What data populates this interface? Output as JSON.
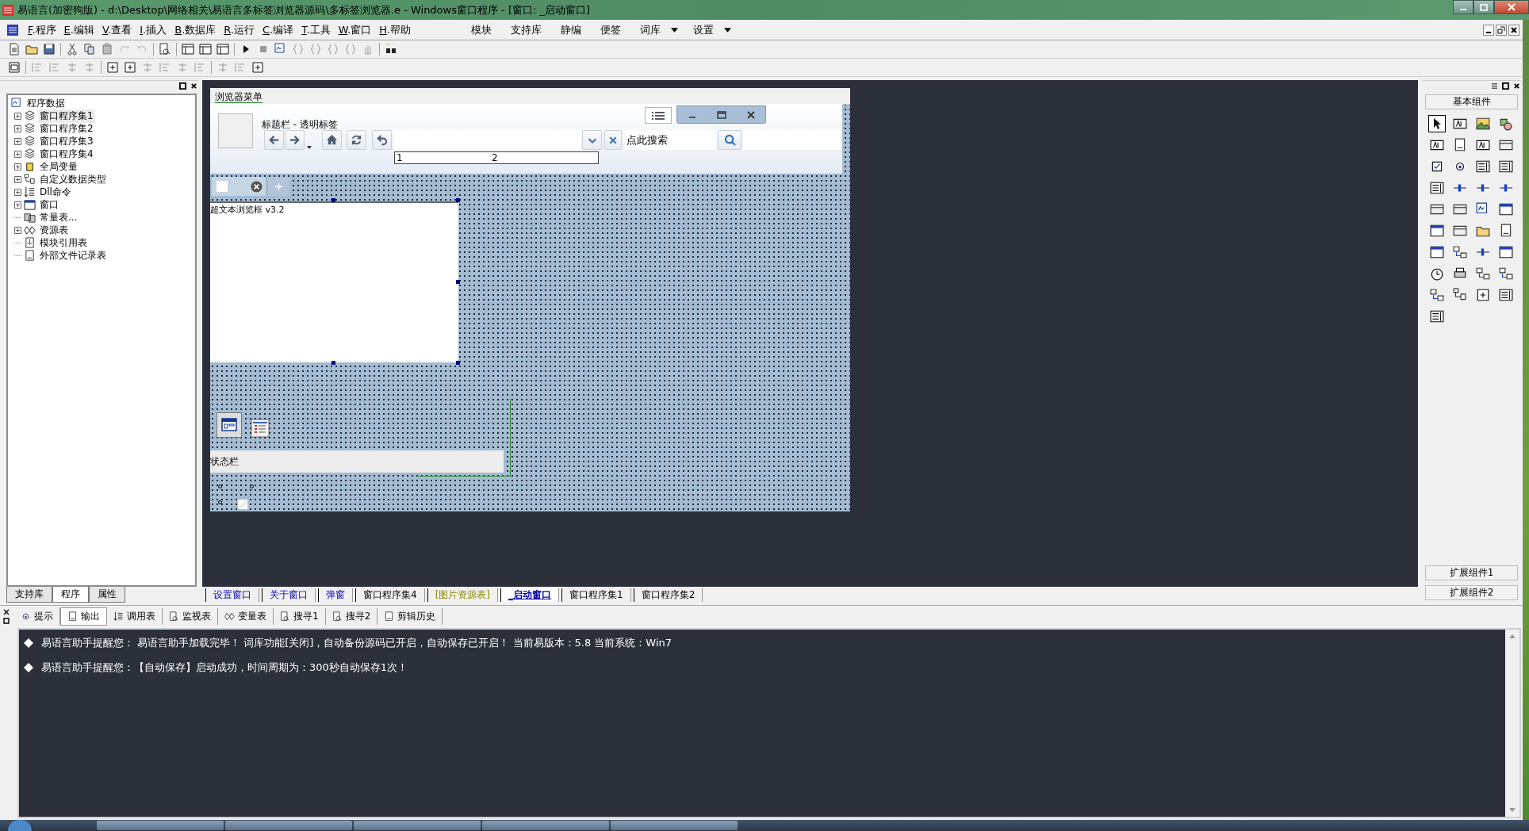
{
  "window": {
    "title": "易语言(加密狗版) - d:\\Desktop\\网络相关\\易语言多标签浏览器源码\\多标签浏览器.e - Windows窗口程序 - [窗口: _启动窗口]"
  },
  "menu": [
    {
      "label": "F.程序"
    },
    {
      "label": "E.编辑"
    },
    {
      "label": "V.查看"
    },
    {
      "label": "I.插入"
    },
    {
      "label": "B.数据库"
    },
    {
      "label": "R.运行"
    },
    {
      "label": "C.编译"
    },
    {
      "label": "T.工具"
    },
    {
      "label": "W.窗口"
    },
    {
      "label": "H.帮助"
    }
  ],
  "menu_right": [
    {
      "label": "模块",
      "dropdown": false
    },
    {
      "label": "支持库",
      "dropdown": false
    },
    {
      "label": "静编",
      "dropdown": false
    },
    {
      "label": "便签",
      "dropdown": false
    },
    {
      "label": "词库",
      "dropdown": true
    },
    {
      "label": "设置",
      "dropdown": true
    }
  ],
  "tree": {
    "label": "程序数据",
    "children": [
      {
        "label": "窗口程序集1",
        "expander": true,
        "selected": true
      },
      {
        "label": "窗口程序集2",
        "expander": true,
        "selected": false
      },
      {
        "label": "窗口程序集3",
        "expander": true,
        "selected": false
      },
      {
        "label": "窗口程序集4",
        "expander": true,
        "selected": false
      },
      {
        "label": "全局变量",
        "expander": true,
        "selected": false
      },
      {
        "label": "自定义数据类型",
        "expander": true,
        "selected": false
      },
      {
        "label": "Dll命令",
        "expander": true,
        "selected": false
      },
      {
        "label": "窗口",
        "expander": true,
        "selected": false
      },
      {
        "label": "常量表...",
        "expander": false,
        "selected": false
      },
      {
        "label": "资源表",
        "expander": true,
        "selected": false
      },
      {
        "label": "模块引用表",
        "expander": false,
        "selected": false
      },
      {
        "label": "外部文件记录表",
        "expander": false,
        "selected": false
      }
    ]
  },
  "left_tabs": [
    {
      "label": "支持库",
      "selected": false
    },
    {
      "label": "程序",
      "selected": true
    },
    {
      "label": "属性",
      "selected": false
    }
  ],
  "designer": {
    "menu_label": "浏览器菜单",
    "title_label": "标题栏 - 透明标签",
    "ruler": [
      "1",
      "2"
    ],
    "search_placeholder": "点此搜索",
    "browser_label": "超文本浏览框 v3.2",
    "status_label": "状态栏"
  },
  "editor_tabs": [
    {
      "label": "设置窗口",
      "kind": "window",
      "selected": false
    },
    {
      "label": "关于窗口",
      "kind": "window",
      "selected": false
    },
    {
      "label": "弹窗",
      "kind": "window",
      "selected": false
    },
    {
      "label": "窗口程序集4",
      "kind": "module",
      "selected": false
    },
    {
      "label": "[图片资源表]",
      "kind": "resource",
      "selected": false
    },
    {
      "label": "_启动窗口",
      "kind": "window",
      "selected": true
    },
    {
      "label": "窗口程序集1",
      "kind": "module",
      "selected": false
    },
    {
      "label": "窗口程序集2",
      "kind": "module",
      "selected": false
    }
  ],
  "toolbox": {
    "title": "基本组件",
    "pointer_selected": true,
    "footer": [
      "扩展组件1",
      "扩展组件2"
    ]
  },
  "output_tabs": [
    {
      "label": "提示",
      "selected": false
    },
    {
      "label": "输出",
      "selected": true
    },
    {
      "label": "调用表",
      "selected": false
    },
    {
      "label": "监视表",
      "selected": false
    },
    {
      "label": "变量表",
      "selected": false
    },
    {
      "label": "搜寻1",
      "selected": false
    },
    {
      "label": "搜寻2",
      "selected": false
    },
    {
      "label": "剪辑历史",
      "selected": false
    }
  ],
  "output_lines": [
    "易语言助手提醒您： 易语言助手加载完毕！ 词库功能[关闭]，自动备份源码已开启，自动保存已开启！ 当前易版本：5.8  当前系统：Win7",
    "易语言助手提醒您：【自动保存】启动成功，时间周期为：300秒自动保存1次！"
  ]
}
